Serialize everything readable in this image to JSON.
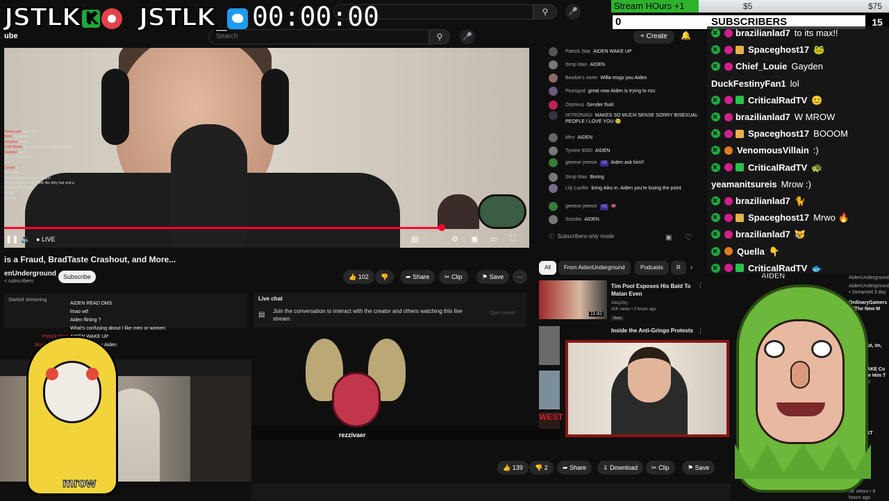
{
  "overlay": {
    "brand1": "JSTLK",
    "brand1_k": "K",
    "brand2": "JSTLK_",
    "timer": "00:00:00"
  },
  "goal": {
    "label": "Stream HOurs +1",
    "mid_amount": "$5",
    "max_amount": "$75",
    "current": "0",
    "title": "SUBSCRIBERS",
    "target": "15"
  },
  "youtube": {
    "logo": "ube",
    "search_placeholder": "Search",
    "create_label": "Create",
    "video": {
      "live_label": "LIVE",
      "progress": 0.83,
      "overlay_chat": [
        {
          "name": "CereaLego",
          "text": "okay bro"
        },
        {
          "name": "Bunz",
          "text": "Hahahaha"
        },
        {
          "name": "JohnAxe",
          "text": "LMAO"
        },
        {
          "name": "Cold Hearts",
          "text": "Oh yeah, your grandma is dead"
        },
        {
          "name": "Grimmel",
          "text": "no!!!!!"
        },
        {
          "name": "",
          "text": "WHAT \"STALKER\""
        },
        {
          "name": "",
          "text": "Lol"
        },
        {
          "name": "Cousin",
          "text": "w"
        },
        {
          "name": "",
          "text": "What the"
        },
        {
          "name": "",
          "text": "That's fucking psycho shit gurl"
        },
        {
          "name": "",
          "text": "@dickdinger do you smell like dirty hair and a"
        },
        {
          "name": "",
          "text": "Chinese fish market"
        },
        {
          "name": "",
          "text": "WHAT"
        },
        {
          "name": "",
          "text": "kick her"
        }
      ]
    },
    "title": "is a Fraud, BradTaste Crashout, and More...",
    "channel": "enUnderground",
    "subscribers": "< subscribers",
    "subscribe_label": "Subscribe",
    "likes": "102",
    "share_label": "Share",
    "clip_label": "Clip",
    "save_label": "Save",
    "left_chat_header": "Started streaming",
    "left_chat": [
      {
        "name": "",
        "text": "AIDEN READ DMS"
      },
      {
        "name": "",
        "text": "lmao wtf"
      },
      {
        "name": "",
        "text": "Aiden flirting ?"
      },
      {
        "name": "",
        "text": "What's confusing about I like men or women"
      },
      {
        "name": "Patrick Star",
        "text": "AIDEN WAKE UP"
      },
      {
        "name": "Bowbie's sister",
        "text": "Willa mogs you Aiden"
      },
      {
        "name": "",
        "text": "AIDEN"
      }
    ],
    "live_chat_title": "Live chat",
    "live_chat_text": "Join the conversation to interact with the creator and others watching this live stream.",
    "open_panel": "Open panel",
    "chat": [
      {
        "name": "Patrick Star",
        "text": "AIDEN WAKE UP",
        "color": "#555"
      },
      {
        "name": "Simp Man",
        "text": "AIDEN",
        "color": "#777"
      },
      {
        "name": "Bowbie's sister",
        "text": "Willa mogs you Aiden",
        "color": "#8a6a6a"
      },
      {
        "name": "Pezisgod",
        "text": "great now Aiden is trying to rizz",
        "color": "#6b5a7b"
      },
      {
        "name": "Orpheus",
        "text": "Gender fluid",
        "color": "#c0235a"
      },
      {
        "name": "NITRONAGI",
        "text": "MAKES SO MUCH SENSE SORRY BISEXUAL PEOPLE I LOVE YOU 😢",
        "color": "#334"
      },
      {
        "name": "Miro",
        "text": "AIDEN",
        "color": "#666"
      },
      {
        "name": "Tyrone 9000",
        "text": "AIDEN",
        "color": "#777"
      },
      {
        "name": "geeese jeeeze",
        "badge": "#3",
        "text": "Aiden ask him!!",
        "color": "#3a7a3a"
      },
      {
        "name": "Simp Man",
        "text": "Boring",
        "color": "#777"
      },
      {
        "name": "Lily Lucifer",
        "text": "bring Aiko in. Aiden you're losing the point",
        "color": "#7a6a8a"
      },
      {
        "name": "geeese jeeeze",
        "badge": "#3",
        "text": "👄",
        "color": "#3a7a3a"
      },
      {
        "name": "Scoobs",
        "text": "AIDEN",
        "color": "#777"
      }
    ],
    "subscribers_only": "Subscribers-only mode",
    "filters": [
      "All",
      "From AidenUnderground",
      "Podcasts",
      "R"
    ],
    "rec1": {
      "title": "Tim Pool Exposes His Bald To Matan Even",
      "channel": "2lazy2try",
      "meta": "41K views • 2 hours ago",
      "badge": "New",
      "duration": "11:42"
    },
    "rec2_title": "Inside the Anti-Gringo Protests",
    "rec4_label": "WEST",
    "moth_name": "rezzivaer",
    "bottom": {
      "likes": "139",
      "dislikes": "2",
      "share": "Share",
      "download": "Download",
      "clip": "Clip",
      "save": "Save"
    },
    "right_list": [
      {
        "title": "",
        "meta": "AidenUnderground"
      },
      {
        "title": "",
        "meta": "AidenUnderground • Streamed 3 day"
      },
      {
        "title": "OrdinaryGamers ? (The New M",
        "meta": ""
      },
      {
        "title": "es Me Out, im, and Mo",
        "meta": ""
      },
      {
        "title": "ahar's FAKE Co and Make Him T",
        "meta": "1 day ago"
      },
      {
        "title": "ACT EPST",
        "meta": ""
      },
      {
        "title": "",
        "meta": "5K views • 8 hours ago"
      }
    ]
  },
  "meme": {
    "caption": "mrow",
    "kermit_label": "AIDEN"
  },
  "twitch_chat": [
    {
      "name": "brazilianlad7",
      "text": "to its max!!",
      "sub": true,
      "gift": "",
      "vip": true
    },
    {
      "name": "Spaceghost17",
      "text": "🐸",
      "sub": true,
      "gift": "gold",
      "vip": true
    },
    {
      "name": "Chief_Louie",
      "text": "Gayden",
      "sub": true,
      "gift": "",
      "vip": true
    },
    {
      "name": "DuckFestinyFan1",
      "text": "lol",
      "sub": false,
      "gift": "",
      "vip": false
    },
    {
      "name": "CriticalRadTV",
      "text": "😊",
      "sub": true,
      "gift": "green",
      "vip": true
    },
    {
      "name": "brazilianlad7",
      "text": "W MROW",
      "sub": true,
      "gift": "",
      "vip": true
    },
    {
      "name": "Spaceghost17",
      "text": "BOOOM",
      "sub": true,
      "gift": "gold",
      "vip": true
    },
    {
      "name": "VenomousVillain",
      "text": ":)",
      "sub": false,
      "gift": "brown",
      "vip": true
    },
    {
      "name": "CriticalRadTV",
      "text": "🐢",
      "sub": true,
      "gift": "green",
      "vip": true
    },
    {
      "name": "yeamanitsureis",
      "text": "Mrow :)",
      "sub": false,
      "gift": "",
      "vip": false
    },
    {
      "name": "brazilianlad7",
      "text": "🐈",
      "sub": true,
      "gift": "",
      "vip": true
    },
    {
      "name": "Spaceghost17",
      "text": "Mrwo 🔥",
      "sub": true,
      "gift": "gold",
      "vip": true
    },
    {
      "name": "brazilianlad7",
      "text": "😿",
      "sub": true,
      "gift": "",
      "vip": true
    },
    {
      "name": "Quella",
      "text": "👇",
      "sub": false,
      "gift": "brown",
      "vip": true
    },
    {
      "name": "CriticalRadTV",
      "text": "🐟",
      "sub": true,
      "gift": "green",
      "vip": true
    }
  ]
}
